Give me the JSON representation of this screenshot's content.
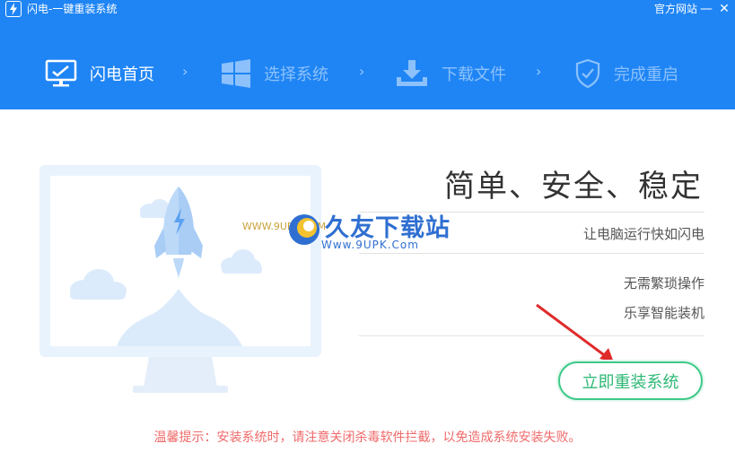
{
  "window": {
    "title": "闪电-一键重装系统",
    "official_site": "官方网站",
    "minimize": "—",
    "close": "✕"
  },
  "steps": [
    {
      "label": "闪电首页",
      "icon": "monitor-icon",
      "active": true
    },
    {
      "label": "选择系统",
      "icon": "windows-logo-icon",
      "active": false
    },
    {
      "label": "下载文件",
      "icon": "download-icon",
      "active": false
    },
    {
      "label": "完成重启",
      "icon": "shield-check-icon",
      "active": false
    }
  ],
  "step_arrow": "›",
  "main": {
    "slogan": "简单、安全、稳定",
    "subtitle": "让电脑运行快如闪电",
    "feature_1": "无需繁琐操作",
    "feature_2": "乐享智能装机",
    "install_button": "立即重装系统",
    "tip": "温馨提示：安装系统时，请注意关闭杀毒软件拦截，以免造成系统安装失败。"
  },
  "watermark": {
    "brand": "久友下载站",
    "url": "Www.9UPK.Com",
    "small": "WWW.9UPK.COM"
  },
  "colors": {
    "header_bg": "#1f85f5",
    "accent_green": "#3dc988",
    "tip_red": "#f06a6a"
  }
}
